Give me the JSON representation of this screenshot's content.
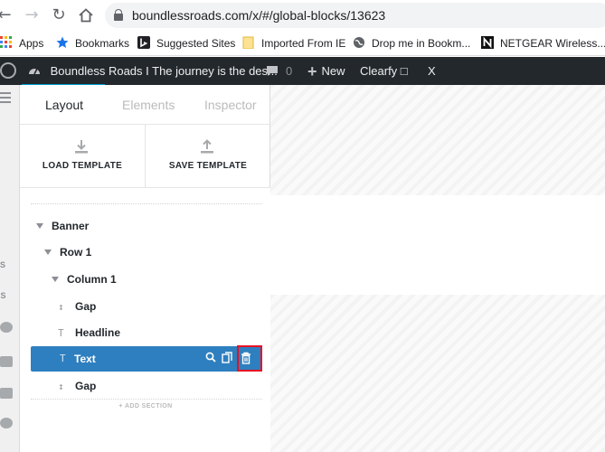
{
  "browser": {
    "url": "boundlessroads.com/x/#/global-blocks/13623",
    "bookmarks": [
      {
        "label": "Apps",
        "icon": "apps-grid-icon"
      },
      {
        "label": "Bookmarks",
        "icon": "star-icon"
      },
      {
        "label": "Suggested Sites",
        "icon": "bing-icon"
      },
      {
        "label": "Imported From IE",
        "icon": "folder-icon"
      },
      {
        "label": "Drop me in Bookm...",
        "icon": "globe-icon"
      },
      {
        "label": "NETGEAR Wireless...",
        "icon": "netgear-icon"
      }
    ]
  },
  "admin_bar": {
    "site_title": "Boundless Roads I The journey is the des...",
    "comments_count": "0",
    "new_label": "New",
    "clearfy_label": "Clearfy □",
    "close_label": "X"
  },
  "left_menu": {
    "labels": [
      "SS",
      "US"
    ]
  },
  "panel": {
    "tabs": [
      "Layout",
      "Elements",
      "Inspector"
    ],
    "load_template": "LOAD TEMPLATE",
    "save_template": "SAVE TEMPLATE",
    "tree": {
      "banner": "Banner",
      "row": "Row 1",
      "column": "Column 1",
      "gap1": "Gap",
      "headline": "Headline",
      "text": "Text",
      "gap2": "Gap"
    },
    "add_section": "+ ADD SECTION"
  },
  "colors": {
    "admin_bar": "#23282d",
    "selected_row": "#2e7fbf",
    "highlight_box": "#e81123"
  }
}
